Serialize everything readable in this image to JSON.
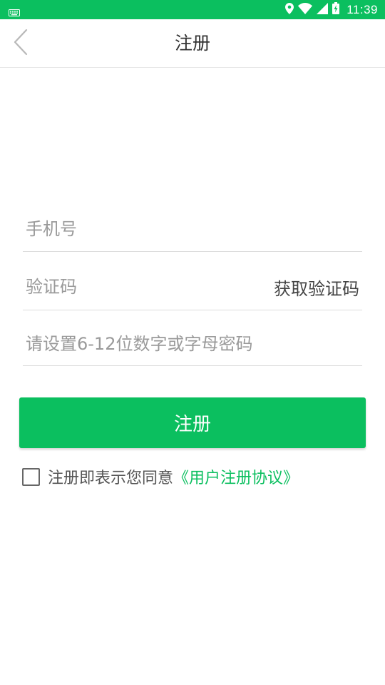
{
  "colors": {
    "accent": "#0bbf5f",
    "link": "#0bbf5f",
    "title_text": "#333333",
    "placeholder_text": "#9a9a9a",
    "divider": "#dcdcdc"
  },
  "status_bar": {
    "time": "11:39",
    "icons": [
      "keyboard-icon",
      "location-icon",
      "wifi-icon",
      "signal-icon",
      "battery-charging-icon"
    ]
  },
  "app_bar": {
    "title": "注册",
    "back_icon": "chevron-left-icon"
  },
  "form": {
    "phone": {
      "value": "",
      "placeholder": "手机号"
    },
    "code": {
      "value": "",
      "placeholder": "验证码",
      "action_label": "获取验证码"
    },
    "password": {
      "value": "",
      "placeholder": "请设置6-12位数字或字母密码"
    },
    "submit_label": "注册"
  },
  "agreement": {
    "checked": false,
    "text": "注册即表示您同意",
    "link_text": "《用户注册协议》"
  }
}
